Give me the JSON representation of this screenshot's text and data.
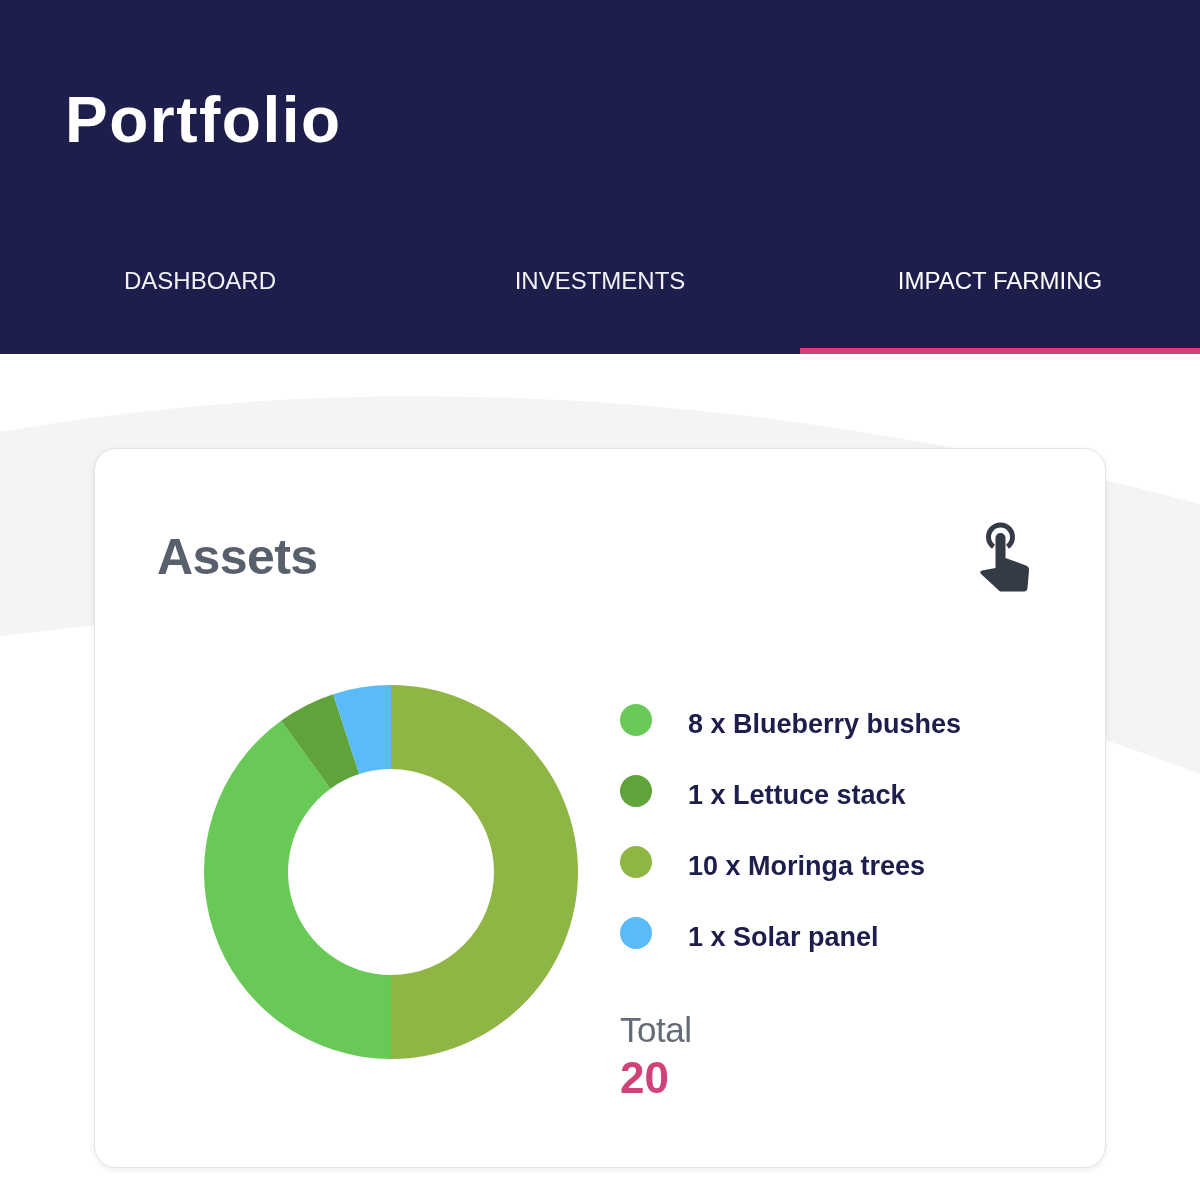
{
  "header": {
    "title": "Portfolio"
  },
  "tabs": [
    {
      "label": "DASHBOARD",
      "selected": false
    },
    {
      "label": "INVESTMENTS",
      "selected": false
    },
    {
      "label": "IMPACT FARMING",
      "selected": true
    }
  ],
  "assets_card": {
    "title": "Assets",
    "legend": [
      {
        "label": "8 x Blueberry bushes",
        "color": "#69c957"
      },
      {
        "label": "1 x Lettuce stack",
        "color": "#5fa33a"
      },
      {
        "label": "10 x Moringa trees",
        "color": "#8fb544"
      },
      {
        "label": "1 x Solar panel",
        "color": "#59bbf8"
      }
    ],
    "total_label": "Total",
    "total_value": "20",
    "chart_data": {
      "type": "donut",
      "values": [
        50,
        40,
        5,
        5
      ],
      "colors": [
        "#8fb544",
        "#69c957",
        "#5fa33a",
        "#59bbf8"
      ]
    }
  }
}
